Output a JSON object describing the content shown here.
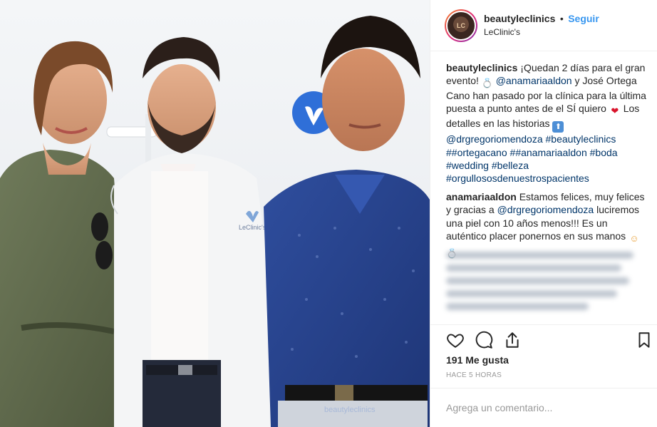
{
  "post": {
    "username": "beautyleclinics",
    "separator": "•",
    "follow_label": "Seguir",
    "location": "LeClinic's",
    "avatar_text": "LC"
  },
  "photo": {
    "coat_logo_text": "LeClinic's",
    "watermark_text": "beautyleclinics"
  },
  "comments": [
    {
      "user": "beautyleclinics",
      "parts": [
        {
          "t": "text",
          "v": "¡Quedan 2 días para el gran evento! "
        },
        {
          "t": "emoji",
          "v": "ring"
        },
        {
          "t": "text",
          "v": " "
        },
        {
          "t": "mention",
          "v": "@anamariaaldon"
        },
        {
          "t": "text",
          "v": " y José Ortega Cano han pasado por la clínica para la última puesta a punto antes de el SÍ quiero "
        },
        {
          "t": "emoji",
          "v": "heart"
        },
        {
          "t": "text",
          "v": " Los detalles en las historias "
        },
        {
          "t": "emoji",
          "v": "up-arrow"
        },
        {
          "t": "text",
          "v": " "
        },
        {
          "t": "mention",
          "v": "@drgregoriomendoza"
        },
        {
          "t": "text",
          "v": " "
        },
        {
          "t": "tag",
          "v": "#beautyleclinics"
        },
        {
          "t": "text",
          "v": " "
        },
        {
          "t": "tag",
          "v": "##ortegacano"
        },
        {
          "t": "text",
          "v": " "
        },
        {
          "t": "tag",
          "v": "##anamariaaldon"
        },
        {
          "t": "text",
          "v": " "
        },
        {
          "t": "tag",
          "v": "#boda"
        },
        {
          "t": "text",
          "v": " "
        },
        {
          "t": "tag",
          "v": "#wedding"
        },
        {
          "t": "text",
          "v": " "
        },
        {
          "t": "tag",
          "v": "#belleza"
        },
        {
          "t": "text",
          "v": " "
        },
        {
          "t": "tag",
          "v": "#orgullososdenuestrospacientes"
        }
      ]
    },
    {
      "user": "anamariaaldon",
      "parts": [
        {
          "t": "text",
          "v": "Estamos felices, muy felices y gracias a "
        },
        {
          "t": "mention",
          "v": "@drgregoriomendoza"
        },
        {
          "t": "text",
          "v": " luciremos una piel con 10 años menos!!! Es un auténtico placer ponernos en sus manos "
        },
        {
          "t": "emoji",
          "v": "face"
        },
        {
          "t": "text",
          "v": " "
        },
        {
          "t": "emoji",
          "v": "ring"
        }
      ]
    }
  ],
  "actions": {
    "like_icon": "heart-outline-icon",
    "comment_icon": "comment-bubble-icon",
    "share_icon": "share-icon",
    "save_icon": "bookmark-icon"
  },
  "likes_label": "191 Me gusta",
  "time_label": "HACE 5 HORAS",
  "add_comment_placeholder": "Agrega un comentario...",
  "colors": {
    "link": "#003569",
    "follow": "#3897f0",
    "muted": "#999999",
    "text": "#262626"
  }
}
